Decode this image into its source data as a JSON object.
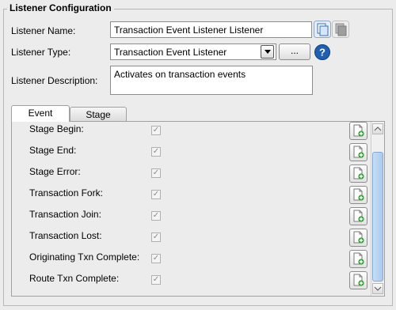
{
  "group": {
    "title": "Listener Configuration"
  },
  "form": {
    "name_label": "Listener Name:",
    "name_value": "Transaction Event Listener Listener",
    "type_label": "Listener Type:",
    "type_value": "Transaction Event Listener",
    "browse_label": "...",
    "help_label": "?",
    "description_label": "Listener Description:",
    "description_value": "Activates on transaction events"
  },
  "tabs": [
    {
      "label": "Event",
      "selected": true
    },
    {
      "label": "Stage",
      "selected": false
    }
  ],
  "events": [
    {
      "label": "Stage Begin:",
      "checked": true
    },
    {
      "label": "Stage End:",
      "checked": true
    },
    {
      "label": "Stage Error:",
      "checked": true
    },
    {
      "label": "Transaction Fork:",
      "checked": true
    },
    {
      "label": "Transaction Join:",
      "checked": true
    },
    {
      "label": "Transaction Lost:",
      "checked": true
    },
    {
      "label": "Originating Txn Complete:",
      "checked": true
    },
    {
      "label": "Route Txn Complete:",
      "checked": true
    }
  ],
  "colors": {
    "help_icon": "#1f5fb0",
    "add_icon": "#2e9e2e"
  }
}
